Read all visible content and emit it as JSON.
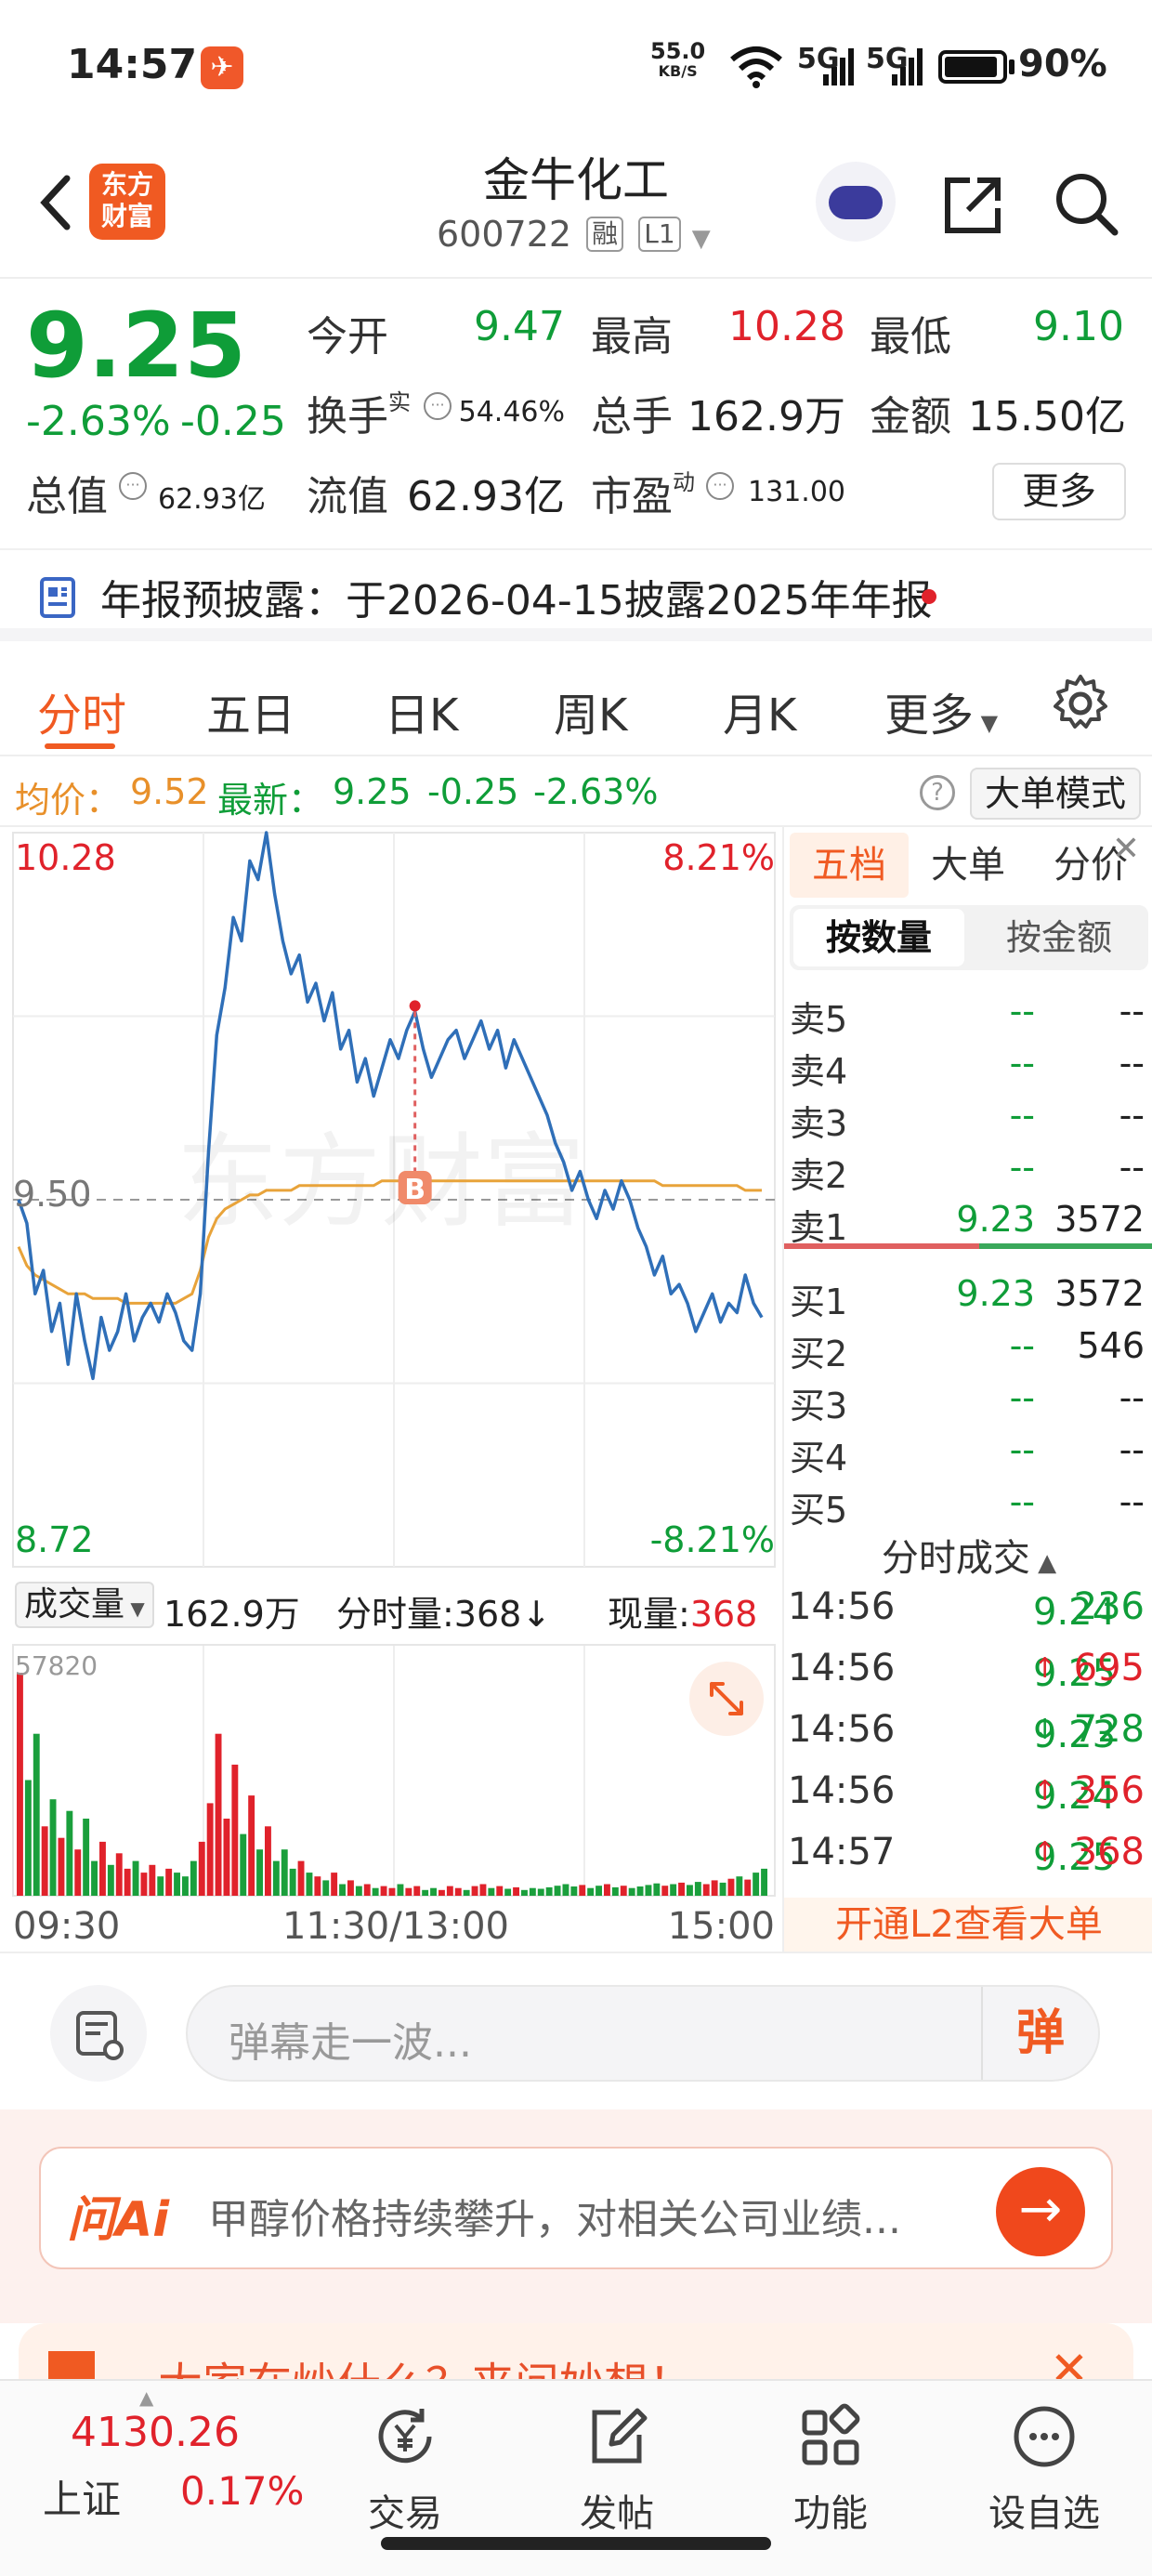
{
  "status_bar": {
    "time": "14:57",
    "net_speed": "55.0",
    "net_unit": "KB/S",
    "sig1": "5G",
    "sig2": "5G",
    "battery": "90%"
  },
  "header": {
    "logo": "东方财富",
    "name": "金牛化工",
    "code": "600722",
    "tag1": "融",
    "tag2": "L1"
  },
  "quote": {
    "price": "9.25",
    "change_pct": "-2.63%",
    "change": "-0.25",
    "open_label": "今开",
    "open": "9.47",
    "high_label": "最高",
    "high": "10.28",
    "low_label": "最低",
    "low": "9.10",
    "turnover_label": "换手",
    "turnover_sup": "实",
    "turnover": "54.46%",
    "volume_label": "总手",
    "volume": "162.9万",
    "amount_label": "金额",
    "amount": "15.50亿",
    "mktcap_label": "总值",
    "mktcap": "62.93亿",
    "float_label": "流值",
    "float": "62.93亿",
    "pe_label": "市盈",
    "pe_sup": "动",
    "pe": "131.00",
    "more": "更多"
  },
  "announcement": {
    "text": "年报预披露：于2026-04-15披露2025年年报"
  },
  "tabs": [
    "分时",
    "五日",
    "日K",
    "周K",
    "月K",
    "更多"
  ],
  "avg_line": {
    "avg_label": "均价：",
    "avg": "9.52",
    "latest_label": "最新：",
    "latest": "9.25",
    "chg": "-0.25",
    "pct": "-2.63%",
    "mode_btn": "大单模式"
  },
  "chart_labels": {
    "max_price": "10.28",
    "max_pct": "8.21%",
    "min_price": "8.72",
    "min_pct": "-8.21%",
    "ref": "9.50",
    "marker": "B",
    "watermark": "东方财富",
    "vol_dropdown": "成交量",
    "vol_total": "162.9万",
    "vol_min_label": "分时量:368",
    "vol_now_label": "现量:",
    "vol_now": "368",
    "vol_max": "57820",
    "t_start": "09:30",
    "t_mid": "11:30/13:00",
    "t_end": "15:00"
  },
  "chart_data": {
    "type": "line",
    "title": "",
    "y_range": [
      8.72,
      10.28
    ],
    "prev_close": 9.5,
    "x_ticks": [
      "09:30",
      "11:30/13:00",
      "15:00"
    ],
    "series": [
      {
        "name": "",
        "values": [
          9.5,
          9.45,
          9.3,
          9.35,
          9.22,
          9.28,
          9.15,
          9.3,
          9.2,
          9.12,
          9.25,
          9.18,
          9.22,
          9.3,
          9.2,
          9.25,
          9.28,
          9.24,
          9.3,
          9.26,
          9.2,
          9.18,
          9.3,
          9.6,
          9.85,
          9.95,
          10.1,
          10.05,
          10.22,
          10.18,
          10.28,
          10.15,
          10.05,
          9.98,
          10.02,
          9.92,
          9.96,
          9.88,
          9.94,
          9.82,
          9.86,
          9.75,
          9.8,
          9.72,
          9.78,
          9.84,
          9.8,
          9.86,
          9.9,
          9.82,
          9.76,
          9.8,
          9.84,
          9.86,
          9.8,
          9.84,
          9.88,
          9.82,
          9.86,
          9.78,
          9.84,
          9.8,
          9.76,
          9.72,
          9.68,
          9.62,
          9.58,
          9.52,
          9.56,
          9.5,
          9.46,
          9.52,
          9.48,
          9.54,
          9.5,
          9.44,
          9.4,
          9.34,
          9.38,
          9.3,
          9.32,
          9.28,
          9.22,
          9.26,
          9.3,
          9.24,
          9.28,
          9.26,
          9.34,
          9.28,
          9.25
        ]
      },
      {
        "name": "",
        "values": [
          9.4,
          9.36,
          9.34,
          9.33,
          9.32,
          9.31,
          9.3,
          9.3,
          9.3,
          9.29,
          9.29,
          9.29,
          9.29,
          9.28,
          9.28,
          9.28,
          9.28,
          9.28,
          9.28,
          9.28,
          9.29,
          9.3,
          9.35,
          9.42,
          9.46,
          9.48,
          9.49,
          9.5,
          9.51,
          9.51,
          9.52,
          9.52,
          9.52,
          9.52,
          9.53,
          9.53,
          9.53,
          9.53,
          9.53,
          9.53,
          9.53,
          9.53,
          9.53,
          9.53,
          9.54,
          9.54,
          9.54,
          9.54,
          9.54,
          9.54,
          9.54,
          9.54,
          9.54,
          9.54,
          9.54,
          9.54,
          9.54,
          9.54,
          9.54,
          9.54,
          9.54,
          9.54,
          9.54,
          9.54,
          9.54,
          9.54,
          9.54,
          9.54,
          9.54,
          9.54,
          9.54,
          9.54,
          9.54,
          9.54,
          9.54,
          9.54,
          9.54,
          9.54,
          9.53,
          9.53,
          9.53,
          9.53,
          9.53,
          9.53,
          9.53,
          9.53,
          9.53,
          9.53,
          9.52,
          9.52,
          9.52
        ]
      }
    ],
    "volume": {
      "max": 57820,
      "values": [
        57820,
        30000,
        42000,
        18000,
        25000,
        15000,
        22000,
        12000,
        20000,
        9000,
        14000,
        8000,
        11000,
        7000,
        9000,
        6000,
        8000,
        5000,
        7000,
        6000,
        5000,
        9000,
        14000,
        24000,
        42000,
        20000,
        34000,
        16000,
        26000,
        12000,
        18000,
        9000,
        12000,
        7000,
        9000,
        6000,
        5000,
        4000,
        6000,
        3000,
        4000,
        2500,
        3000,
        2000,
        2500,
        2000,
        3000,
        2000,
        2500,
        1500,
        2000,
        1500,
        2500,
        2000,
        1500,
        2500,
        3000,
        2000,
        2500,
        1800,
        2200,
        1500,
        2000,
        1800,
        2200,
        2600,
        3000,
        2400,
        2800,
        2000,
        2600,
        3000,
        2200,
        2600,
        2000,
        2400,
        2800,
        3200,
        2600,
        3000,
        3400,
        2800,
        3600,
        3000,
        4000,
        3400,
        4400,
        5000,
        4200,
        6000,
        7000
      ]
    }
  },
  "order_book": {
    "tabs": [
      "五档",
      "大单",
      "分价"
    ],
    "seg": [
      "按数量",
      "按金额"
    ],
    "asks": [
      {
        "name": "卖5",
        "price": "--",
        "vol": "--"
      },
      {
        "name": "卖4",
        "price": "--",
        "vol": "--"
      },
      {
        "name": "卖3",
        "price": "--",
        "vol": "--"
      },
      {
        "name": "卖2",
        "price": "--",
        "vol": "--"
      },
      {
        "name": "卖1",
        "price": "9.23",
        "vol": "3572"
      }
    ],
    "bids": [
      {
        "name": "买1",
        "price": "9.23",
        "vol": "3572"
      },
      {
        "name": "买2",
        "price": "--",
        "vol": "546"
      },
      {
        "name": "买3",
        "price": "--",
        "vol": "--"
      },
      {
        "name": "买4",
        "price": "--",
        "vol": "--"
      },
      {
        "name": "买5",
        "price": "--",
        "vol": "--"
      }
    ],
    "trade_title": "分时成交",
    "trades": [
      {
        "time": "14:56",
        "price": "9.24",
        "arrow": "",
        "vol": "236"
      },
      {
        "time": "14:56",
        "price": "9.25",
        "arrow": "↑",
        "vol": "695"
      },
      {
        "time": "14:56",
        "price": "9.23",
        "arrow": "↓",
        "vol": "728"
      },
      {
        "time": "14:56",
        "price": "9.24",
        "arrow": "↑",
        "vol": "356"
      },
      {
        "time": "14:57",
        "price": "9.25",
        "arrow": "↑",
        "vol": "368"
      }
    ],
    "l2": "开通L2查看大单"
  },
  "comment": {
    "placeholder": "弹幕走一波...",
    "danmu": "弹"
  },
  "ai": {
    "logo": "问Ai",
    "text": "甲醇价格持续攀升，对相关公司业绩...",
    "go": "→"
  },
  "promo": {
    "text": "大家在炒什么？来问妙想！"
  },
  "bottom_nav": {
    "index_value": "4130.26",
    "index_name": "上证",
    "index_pct": "0.17%",
    "items": [
      "交易",
      "发帖",
      "功能",
      "设自选"
    ]
  },
  "colors": {
    "up": "#e0222b",
    "down": "#0f9d38",
    "price_line": "#2f6fb8",
    "avg_line": "#e8a33a",
    "brand": "#f05a22"
  }
}
